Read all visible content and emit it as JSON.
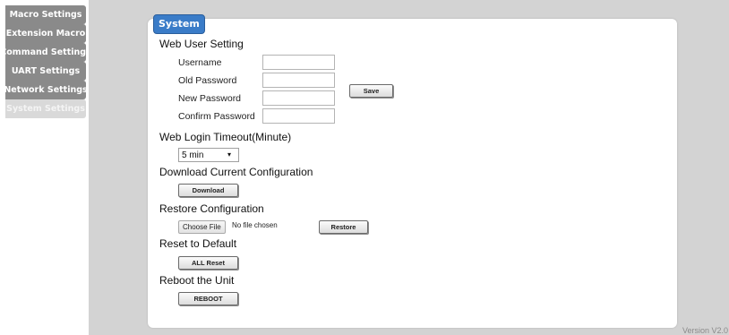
{
  "sidebar": {
    "items": [
      {
        "label": "Macro Settings"
      },
      {
        "label": "Extension Macro"
      },
      {
        "label": "Command Settings"
      },
      {
        "label": "UART Settings"
      },
      {
        "label": "Network Settings"
      },
      {
        "label": "System Settings"
      }
    ]
  },
  "panel": {
    "title": "System"
  },
  "web_user": {
    "heading": "Web User Setting",
    "username_label": "Username",
    "old_password_label": "Old Password",
    "new_password_label": "New Password",
    "confirm_password_label": "Confirm Password",
    "username_value": "",
    "old_password_value": "",
    "new_password_value": "",
    "confirm_password_value": "",
    "save_label": "Save"
  },
  "timeout": {
    "heading": "Web Login Timeout(Minute)",
    "selected": "5 min"
  },
  "download": {
    "heading": "Download Current Configuration",
    "button": "Download"
  },
  "restore": {
    "heading": "Restore Configuration",
    "choose_file": "Choose File",
    "file_status": "No file chosen",
    "button": "Restore"
  },
  "reset": {
    "heading": "Reset to Default",
    "button": "ALL Reset"
  },
  "reboot": {
    "heading": "Reboot the Unit",
    "button": "REBOOT"
  },
  "footer": {
    "version": "Version V2.0"
  },
  "colors": {
    "sidebar_item": "#8a8a8a",
    "sidebar_active": "#d9d9d9",
    "panel_tab": "#3a7cc8",
    "background": "#d3d3d3"
  }
}
